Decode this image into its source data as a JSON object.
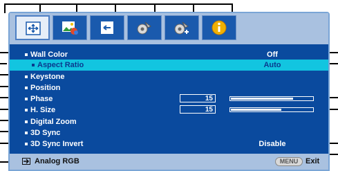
{
  "tabs": [
    {
      "name": "display-icon",
      "active": true
    },
    {
      "name": "picture-icon",
      "active": false
    },
    {
      "name": "source-icon",
      "active": false
    },
    {
      "name": "system-setup-basic-icon",
      "active": false
    },
    {
      "name": "system-setup-advanced-icon",
      "active": false
    },
    {
      "name": "information-icon",
      "active": false
    }
  ],
  "menu": {
    "items": [
      {
        "label": "Wall Color",
        "value": "Off"
      },
      {
        "label": "Aspect Ratio",
        "value": "Auto",
        "selected": true
      },
      {
        "label": "Keystone"
      },
      {
        "label": "Position"
      },
      {
        "label": "Phase",
        "number": "15",
        "level": 0.76
      },
      {
        "label": "H. Size",
        "number": "15",
        "level": 0.62
      },
      {
        "label": "Digital Zoom"
      },
      {
        "label": "3D Sync"
      },
      {
        "label": "3D Sync Invert",
        "value": "Disable"
      }
    ]
  },
  "footer": {
    "source_label": "Analog RGB",
    "menu_key": "MENU",
    "exit_label": "Exit"
  },
  "colors": {
    "background": "#0a4a9e",
    "highlight": "#12c5e0",
    "bar_band": "#a9c1e0"
  }
}
